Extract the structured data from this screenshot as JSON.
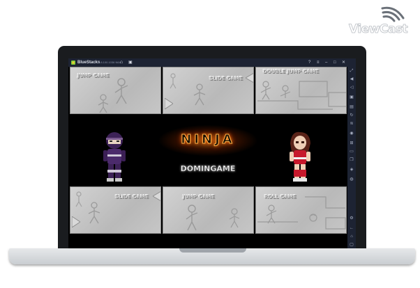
{
  "watermark": {
    "brand": "ViewCast"
  },
  "window": {
    "app_name": "BlueStacks",
    "version": "5.8.100.1036 N64",
    "controls": [
      "?",
      "≡",
      "–",
      "□",
      "✕"
    ]
  },
  "game": {
    "title": "NINJA",
    "studio": "DOMINGAME",
    "panels_top": [
      "JUMP GAME",
      "SLIDE GAME",
      "DOUBLE JUMP GAME"
    ],
    "panels_bottom": [
      "SLIDE GAME",
      "JUMP GAME",
      "ROLL GAME"
    ]
  },
  "colors": {
    "titlebar": "#1d2333",
    "panel": "#c4c4c4",
    "title_glow": "#ff7a1a",
    "ninja_purple": "#4b2a6b",
    "kunoichi_red": "#c7182b"
  },
  "sidebar_icons": [
    "expand-icon",
    "volume-up-icon",
    "volume-down-icon",
    "screen-record-icon",
    "keyboard-icon",
    "rotate-icon",
    "shake-icon",
    "camera-icon",
    "macro-icon",
    "folder-icon",
    "copy-icon",
    "layers-icon",
    "eco-icon",
    "settings-icon",
    "back-icon",
    "home-icon",
    "recents-icon"
  ]
}
